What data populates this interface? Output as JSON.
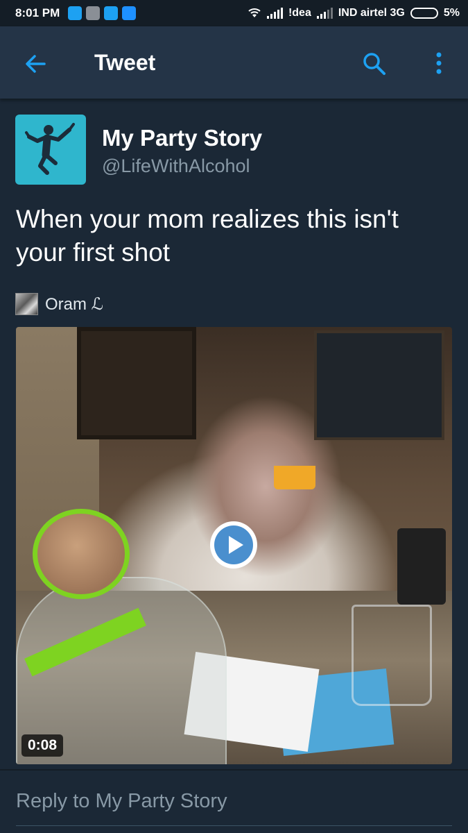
{
  "status_bar": {
    "time": "8:01 PM",
    "carrier1": "!dea",
    "carrier2": "IND airtel 3G",
    "battery": "5%"
  },
  "app_bar": {
    "title": "Tweet",
    "colors": {
      "accent": "#1da1f2",
      "background": "#243447"
    }
  },
  "tweet": {
    "display_name": "My Party Story",
    "handle": "@LifeWithAlcohol",
    "text": "When your mom realizes this isn't your first shot",
    "attribution_name": "Oram ℒ",
    "media": {
      "type": "video",
      "duration": "0:08"
    }
  },
  "reply": {
    "placeholder": "Reply to My Party Story"
  },
  "icons": [
    "back-arrow-icon",
    "search-icon",
    "more-vertical-icon",
    "play-icon",
    "party-person-icon"
  ]
}
